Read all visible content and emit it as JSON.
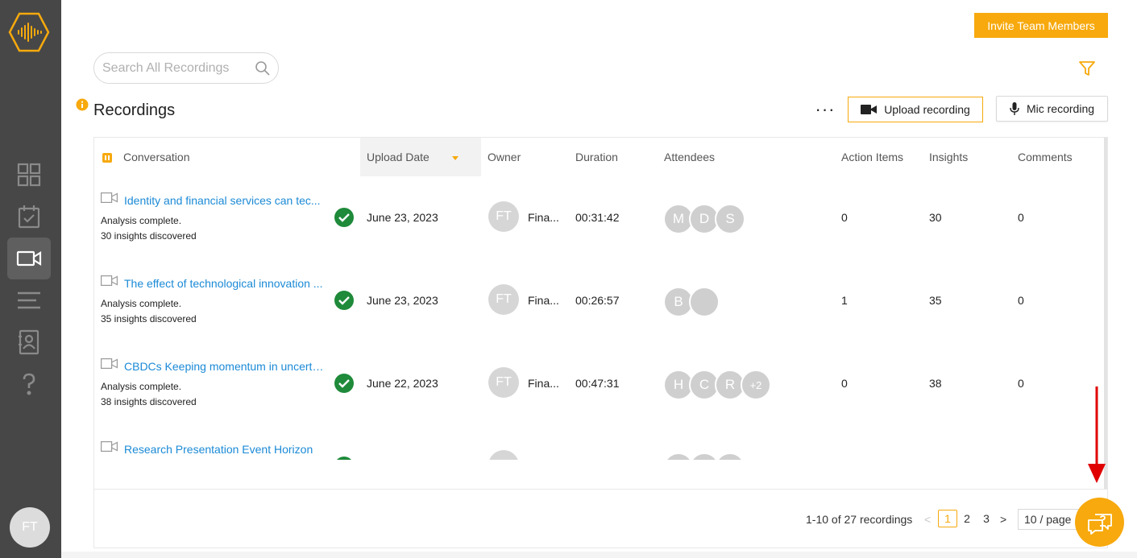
{
  "colors": {
    "accent": "#f7a90d",
    "sidebar": "#474747",
    "link": "#1b8ad6",
    "success": "#1e8a3a",
    "annotation_arrow": "#e00000"
  },
  "sidebar": {
    "logo": "soundwave-hexagon-logo",
    "items": [
      {
        "icon": "grid-icon",
        "active": false
      },
      {
        "icon": "calendar-check-icon",
        "active": false
      },
      {
        "icon": "video-camera-icon",
        "active": true
      },
      {
        "icon": "list-icon",
        "active": false
      },
      {
        "icon": "contacts-icon",
        "active": false
      },
      {
        "icon": "question-mark-icon",
        "active": false
      }
    ],
    "user_initials": "FT"
  },
  "header": {
    "invite_label": "Invite Team Members",
    "search_placeholder": "Search All Recordings"
  },
  "toolbar": {
    "title": "Recordings",
    "more_label": "···",
    "upload_label": "Upload recording",
    "mic_label": "Mic recording"
  },
  "table": {
    "columns": {
      "conversation": "Conversation",
      "upload_date": "Upload Date",
      "owner": "Owner",
      "duration": "Duration",
      "attendees": "Attendees",
      "action_items": "Action Items",
      "insights": "Insights",
      "comments": "Comments"
    },
    "rows": [
      {
        "title": "Identity and financial services can tec...",
        "status": "Analysis complete.",
        "insights_text": "30 insights discovered",
        "date": "June 23, 2023",
        "owner_initials": "FT",
        "owner_name": "Fina...",
        "duration": "00:31:42",
        "attendees": [
          "M",
          "D",
          "S"
        ],
        "action_items": "0",
        "insights": "30",
        "comments": "0"
      },
      {
        "title": "The effect of technological innovation ...",
        "status": "Analysis complete.",
        "insights_text": "35 insights discovered",
        "date": "June 23, 2023",
        "owner_initials": "FT",
        "owner_name": "Fina...",
        "duration": "00:26:57",
        "attendees": [
          "B",
          ""
        ],
        "action_items": "1",
        "insights": "35",
        "comments": "0"
      },
      {
        "title": "CBDCs Keeping momentum in uncerta...",
        "status": "Analysis complete.",
        "insights_text": "38 insights discovered",
        "date": "June 22, 2023",
        "owner_initials": "FT",
        "owner_name": "Fina...",
        "duration": "00:47:31",
        "attendees": [
          "H",
          "C",
          "R",
          "+2"
        ],
        "action_items": "0",
        "insights": "38",
        "comments": "0"
      },
      {
        "title": "Research Presentation Event Horizon",
        "status": "",
        "insights_text": "",
        "date": "",
        "owner_initials": "",
        "owner_name": "",
        "duration": "",
        "attendees": [
          "",
          "",
          ""
        ],
        "action_items": "",
        "insights": "",
        "comments": ""
      }
    ]
  },
  "pagination": {
    "summary": "1-10 of 27 recordings",
    "prev": "<",
    "pages": [
      "1",
      "2",
      "3"
    ],
    "current": "1",
    "next": ">",
    "page_size": "10 / page"
  },
  "help": {
    "icon": "chat-question-icon"
  }
}
